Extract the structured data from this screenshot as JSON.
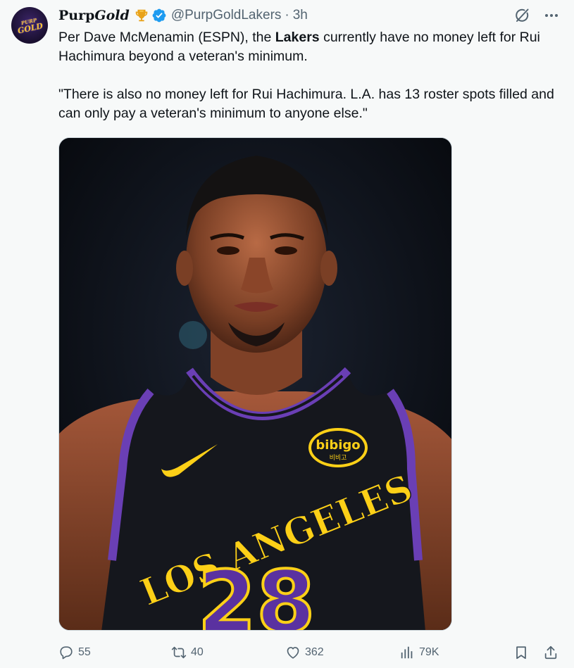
{
  "tweet": {
    "display_name_a": "Purp",
    "display_name_b": "Gold",
    "handle": "@PurpGoldLakers",
    "dot": "·",
    "time": "3h",
    "avatar_text_a": "PURP",
    "avatar_text_b": "GOLD",
    "text_part1": "Per Dave McMenamin (ESPN), the ",
    "text_bold": "Lakers",
    "text_part2": " currently have no money left for Rui Hachimura beyond a veteran's minimum.",
    "quote": "\"There is also no money left for Rui Hachimura. L.A. has 13 roster spots filled and can only pay a veteran's minimum to anyone else.\"",
    "image": {
      "jersey_text": "LOS ANGELES",
      "number": "28",
      "sponsor": "bibigo",
      "sponsor_sub": "비비고"
    }
  },
  "actions": {
    "replies": "55",
    "reposts": "40",
    "likes": "362",
    "views": "79K"
  },
  "icons": {
    "trophy": "trophy-icon",
    "verified": "verified-badge-icon",
    "grok": "grok-icon",
    "more": "more-icon",
    "reply": "reply-icon",
    "repost": "repost-icon",
    "like": "heart-icon",
    "views": "views-icon",
    "bookmark": "bookmark-icon",
    "share": "share-icon"
  },
  "colors": {
    "verified_blue": "#1d9bf0",
    "secondary_text": "#536471",
    "lakers_purple": "#6a3fb5",
    "lakers_gold": "#fdd017"
  }
}
